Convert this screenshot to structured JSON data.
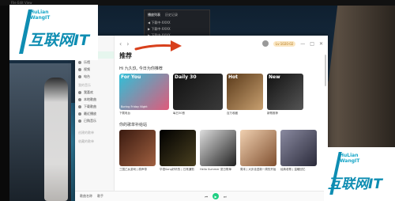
{
  "desktop": {
    "topline": "File  Edit  View"
  },
  "mini_window": {
    "tabs": [
      "播放列表",
      "历史记录"
    ],
    "rows": [
      "◀ 下载中·XXXX",
      "▶ 下载中·XXXX",
      "▶ 下载中·XXXX"
    ]
  },
  "app": {
    "topbar": {
      "back": "‹",
      "forward": "›",
      "vip_label": "Lv·1020·02",
      "min": "—",
      "max": "□",
      "close": "✕"
    },
    "sidebar": {
      "items": [
        {
          "label": "推荐",
          "active": true
        },
        {
          "label": "乐馆"
        },
        {
          "label": "视频"
        },
        {
          "label": "电台"
        }
      ],
      "my_music_head": "我的音乐",
      "my_items": [
        {
          "label": "我喜欢"
        },
        {
          "label": "本地歌曲"
        },
        {
          "label": "下载歌曲"
        },
        {
          "label": "最近播放"
        },
        {
          "label": "已购音乐"
        }
      ],
      "created_head": "创建的歌单",
      "collected_head": "收藏的歌单"
    },
    "main": {
      "title": "推荐",
      "greeting": "Hi 九久玖, 今日为你推荐",
      "featured": [
        {
          "cover_label": "For You",
          "cover_sub": "Boring Friday Night",
          "caption": "下载电台",
          "color": "#2fc0d8"
        },
        {
          "cover_label": "Daily 30",
          "cover_sub": "",
          "caption": "每日30首",
          "color": "#1a1a1a"
        },
        {
          "cover_label": "Hot",
          "cover_sub": "",
          "caption": "百万收藏",
          "color": "#8a5a2a"
        },
        {
          "cover_label": "New",
          "cover_sub": "",
          "caption": "新歌推荐",
          "color": "#222222"
        }
      ],
      "section_title": "你的歌单补给站",
      "playlists": [
        {
          "caption": "三国乙女游戏 | 原声带",
          "color": "#6a3a2a"
        },
        {
          "caption": "华语Song好听的 | 日常通勤",
          "color": "#1a1a1a"
        },
        {
          "caption": "Hello Summer 夏日歌单",
          "color": "#f4f4f4"
        },
        {
          "caption": "周末 | 大步走进新一周的开始",
          "color": "#b08060"
        },
        {
          "caption": "经典老歌 | 温暖回忆",
          "color": "#4a4a5a"
        }
      ]
    },
    "player": {
      "song": "歌曲名称",
      "artist": "歌手",
      "play": "▶",
      "prev": "⏮",
      "next": "⏭"
    }
  },
  "watermark": {
    "small": "HuLian\nWangIT",
    "big": "互联网IT"
  }
}
